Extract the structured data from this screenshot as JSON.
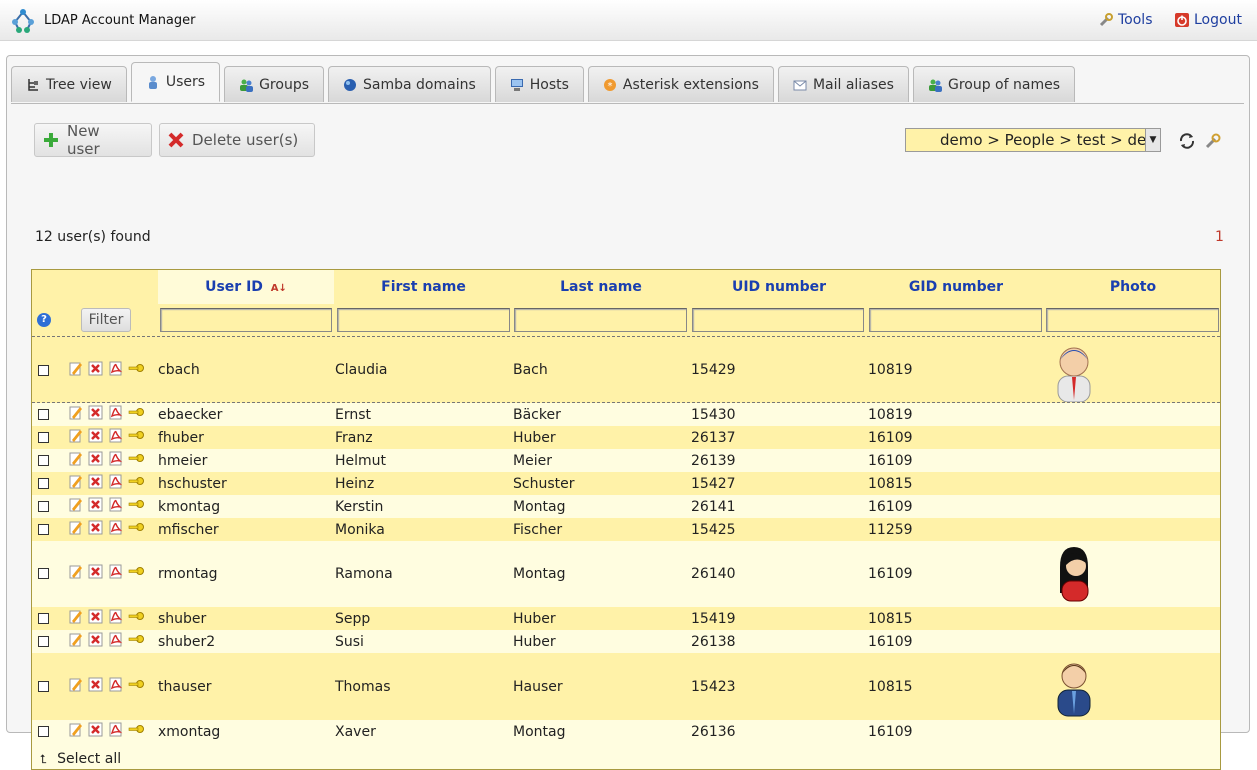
{
  "app": {
    "title": "LDAP Account Manager",
    "tools_label": "Tools",
    "logout_label": "Logout"
  },
  "tabs": [
    {
      "label": "Tree view",
      "icon": "tree-icon"
    },
    {
      "label": "Users",
      "icon": "user-icon",
      "active": true
    },
    {
      "label": "Groups",
      "icon": "groups-icon"
    },
    {
      "label": "Samba domains",
      "icon": "samba-icon"
    },
    {
      "label": "Hosts",
      "icon": "host-icon"
    },
    {
      "label": "Asterisk extensions",
      "icon": "asterisk-icon"
    },
    {
      "label": "Mail aliases",
      "icon": "mail-icon"
    },
    {
      "label": "Group of names",
      "icon": "group-names-icon"
    }
  ],
  "toolbar": {
    "new_user_label": "New user",
    "delete_label": "Delete user(s)",
    "dn_value": "demo > People > test > de"
  },
  "status": {
    "found": "12 user(s) found",
    "page": "1"
  },
  "table": {
    "headers": {
      "user_id": "User ID",
      "first_name": "First name",
      "last_name": "Last name",
      "uid_number": "UID number",
      "gid_number": "GID number",
      "photo": "Photo"
    },
    "filter_label": "Filter",
    "select_all": "Select all",
    "rows": [
      {
        "uid": "cbach",
        "first": "Claudia",
        "last": "Bach",
        "uidn": "15429",
        "gidn": "10819",
        "photo": "male-blue-photo"
      },
      {
        "uid": "ebaecker",
        "first": "Ernst",
        "last": "Bäcker",
        "uidn": "15430",
        "gidn": "10819",
        "photo": ""
      },
      {
        "uid": "fhuber",
        "first": "Franz",
        "last": "Huber",
        "uidn": "26137",
        "gidn": "16109",
        "photo": ""
      },
      {
        "uid": "hmeier",
        "first": "Helmut",
        "last": "Meier",
        "uidn": "26139",
        "gidn": "16109",
        "photo": ""
      },
      {
        "uid": "hschuster",
        "first": "Heinz",
        "last": "Schuster",
        "uidn": "15427",
        "gidn": "10815",
        "photo": ""
      },
      {
        "uid": "kmontag",
        "first": "Kerstin",
        "last": "Montag",
        "uidn": "26141",
        "gidn": "16109",
        "photo": ""
      },
      {
        "uid": "mfischer",
        "first": "Monika",
        "last": "Fischer",
        "uidn": "15425",
        "gidn": "11259",
        "photo": ""
      },
      {
        "uid": "rmontag",
        "first": "Ramona",
        "last": "Montag",
        "uidn": "26140",
        "gidn": "16109",
        "photo": "female-photo"
      },
      {
        "uid": "shuber",
        "first": "Sepp",
        "last": "Huber",
        "uidn": "15419",
        "gidn": "10815",
        "photo": ""
      },
      {
        "uid": "shuber2",
        "first": "Susi",
        "last": "Huber",
        "uidn": "26138",
        "gidn": "16109",
        "photo": ""
      },
      {
        "uid": "thauser",
        "first": "Thomas",
        "last": "Hauser",
        "uidn": "15423",
        "gidn": "10815",
        "photo": "male-tie-photo"
      },
      {
        "uid": "xmontag",
        "first": "Xaver",
        "last": "Montag",
        "uidn": "26136",
        "gidn": "16109",
        "photo": ""
      }
    ]
  },
  "colors": {
    "header_bg": "#fff2a8",
    "row_light": "#fffde0",
    "link": "#1a3fb0",
    "accent_red": "#c0392b"
  }
}
